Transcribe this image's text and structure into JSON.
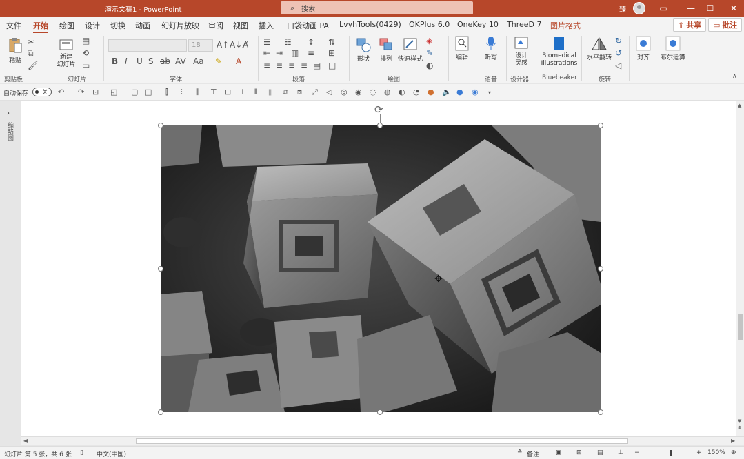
{
  "window": {
    "title": "演示文稿1  -  PowerPoint",
    "search_placeholder": "搜索",
    "user_initial": "臻",
    "min_label": "—",
    "max_label": "☐",
    "close_label": "✕",
    "ribbon_display_icon": "ribbon-display-icon"
  },
  "tabs": [
    {
      "label": "文件"
    },
    {
      "label": "开始"
    },
    {
      "label": "绘图"
    },
    {
      "label": "设计"
    },
    {
      "label": "切换"
    },
    {
      "label": "动画"
    },
    {
      "label": "幻灯片放映"
    },
    {
      "label": "审阅"
    },
    {
      "label": "视图"
    },
    {
      "label": "插入"
    },
    {
      "label": "口袋动画 PA"
    },
    {
      "label": "LvyhTools(0429)"
    },
    {
      "label": "OKPlus 6.0"
    },
    {
      "label": "OneKey 10"
    },
    {
      "label": "ThreeD 7"
    },
    {
      "label": "图片格式"
    }
  ],
  "share_label": "共享",
  "comment_label": "批注",
  "ribbon": {
    "paste_label": "粘贴",
    "clipboard_group": "剪贴板",
    "new_slide_label": "新建\n幻灯片",
    "slides_group": "幻灯片",
    "font_group": "字体",
    "font_size": "18",
    "paragraph_group": "段落",
    "shape_label": "形状",
    "arrange_label": "排列",
    "quick_style_label": "快速样式",
    "drawing_group": "绘图",
    "edit_label": "编辑",
    "dictate_label": "听写",
    "voice_group": "语音",
    "designer_label": "设计\n灵感",
    "designer_group": "设计器",
    "bio_label": "Biomedical\nIllustrations",
    "bio_group": "Bluebeaker",
    "flip_label": "水平翻转",
    "rotate_group": "旋转",
    "align_label": "对齐",
    "boolean_label": "布尔运算"
  },
  "qat": {
    "autosave_label": "自动保存",
    "toggle_label": "关"
  },
  "leftpane": {
    "label": "缩略图"
  },
  "statusbar": {
    "slide_info": "幻灯片 第 5 张，共 6 张",
    "language": "中文(中国)",
    "notes_label": "备注",
    "zoom_value": "150%"
  },
  "colors": {
    "accent": "#b7472a",
    "search_bg": "#eec2b5"
  }
}
